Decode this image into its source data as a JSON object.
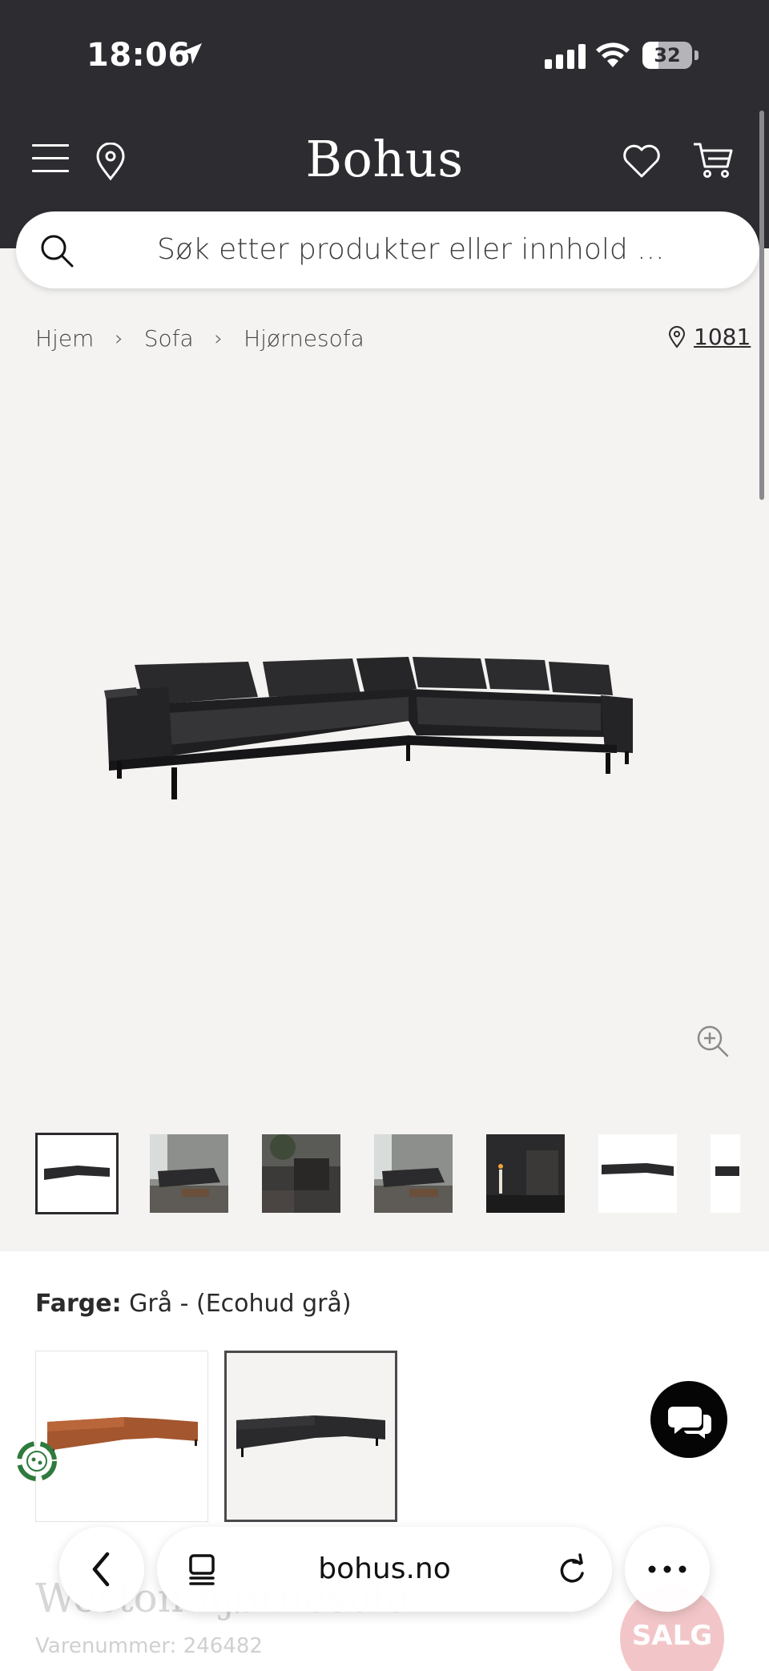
{
  "status_bar": {
    "time": "18:06",
    "battery": "32"
  },
  "header": {
    "logo": "Bohus"
  },
  "search": {
    "placeholder": "Søk etter produkter eller innhold ..."
  },
  "breadcrumb": {
    "items": [
      "Hjem",
      "Sofa",
      "Hjørnesofa"
    ],
    "store": "1081"
  },
  "color_selector": {
    "label": "Farge:",
    "value": "Grå - (Ecohud grå)",
    "options": [
      "brown",
      "grey"
    ],
    "selected_index": 1
  },
  "product": {
    "title": "Weston hjørnesofa",
    "sku": "Varenummer: 246482",
    "badge": "SALG"
  },
  "browser": {
    "url": "bohus.no"
  },
  "colors": {
    "header_bg": "#2d2c31",
    "page_bg": "#f4f3f1",
    "sale_badge": "#f2c6c8"
  }
}
